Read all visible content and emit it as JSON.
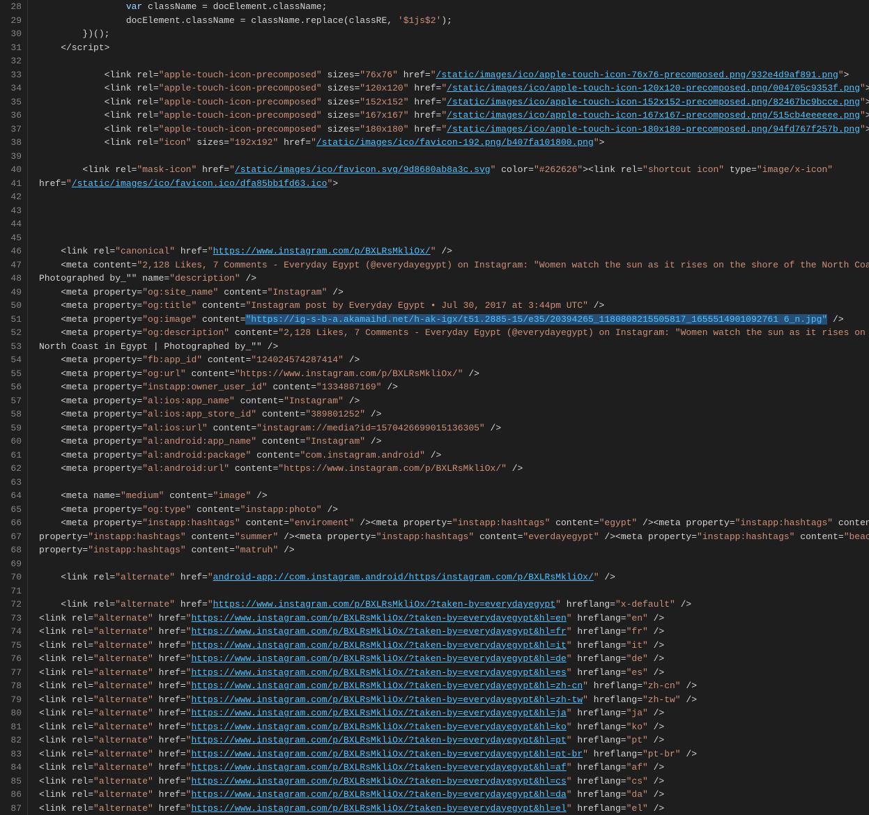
{
  "lines": [
    {
      "num": 28,
      "html": "<span class='plain'>                <span class='js-var'>var</span> className = docElement.className;</span>"
    },
    {
      "num": 29,
      "html": "<span class='plain'>                docElement.className = className.replace(classRE, <span class='js-string'>'$1js$2'</span>);</span>"
    },
    {
      "num": 30,
      "html": "<span class='plain'>        })();</span>"
    },
    {
      "num": 31,
      "html": "<span class='plain'>    &lt;/script&gt;</span>"
    },
    {
      "num": 32,
      "html": ""
    },
    {
      "num": 33,
      "html": "<span class='plain'>            &lt;link rel=<span class='attr-value'>\"apple-touch-icon-precomposed\"</span> sizes=<span class='attr-value'>\"76x76\"</span> href=<span class='attr-value'>\"<span class='link'>/static/images/ico/apple-touch-icon-76x76-precomposed.png/932e4d9af891.png</span>\"</span>&gt;</span>"
    },
    {
      "num": 34,
      "html": "<span class='plain'>            &lt;link rel=<span class='attr-value'>\"apple-touch-icon-precomposed\"</span> sizes=<span class='attr-value'>\"120x120\"</span> href=<span class='attr-value'>\"<span class='link'>/static/images/ico/apple-touch-icon-120x120-precomposed.png/004705c9353f.png</span>\"</span>&gt;</span>"
    },
    {
      "num": 35,
      "html": "<span class='plain'>            &lt;link rel=<span class='attr-value'>\"apple-touch-icon-precomposed\"</span> sizes=<span class='attr-value'>\"152x152\"</span> href=<span class='attr-value'>\"<span class='link'>/static/images/ico/apple-touch-icon-152x152-precomposed.png/82467bc9bcce.png</span>\"</span>&gt;</span>"
    },
    {
      "num": 36,
      "html": "<span class='plain'>            &lt;link rel=<span class='attr-value'>\"apple-touch-icon-precomposed\"</span> sizes=<span class='attr-value'>\"167x167\"</span> href=<span class='attr-value'>\"<span class='link'>/static/images/ico/apple-touch-icon-167x167-precomposed.png/515cb4eeeeee.png</span>\"</span>&gt;</span>"
    },
    {
      "num": 37,
      "html": "<span class='plain'>            &lt;link rel=<span class='attr-value'>\"apple-touch-icon-precomposed\"</span> sizes=<span class='attr-value'>\"180x180\"</span> href=<span class='attr-value'>\"<span class='link'>/static/images/ico/apple-touch-icon-180x180-precomposed.png/94fd767f257b.png</span>\"</span>&gt;</span>"
    },
    {
      "num": 38,
      "html": "<span class='plain'>            &lt;link rel=<span class='attr-value'>\"icon\"</span> sizes=<span class='attr-value'>\"192x192\"</span> href=<span class='attr-value'>\"<span class='link'>/static/images/ico/favicon-192.png/b407fa101800.png</span>\"</span>&gt;</span>"
    },
    {
      "num": 39,
      "html": ""
    },
    {
      "num": 40,
      "html": "<span class='plain'>        &lt;link rel=<span class='attr-value'>\"mask-icon\"</span> href=<span class='attr-value'>\"<span class='link'>/static/images/ico/favicon.svg/9d8680ab8a3c.svg</span>\"</span> color=<span class='attr-value'>\"#262626\"</span>&gt;&lt;link rel=<span class='attr-value'>\"shortcut icon\"</span> type=<span class='attr-value'>\"image/x-icon\"</span></span>"
    },
    {
      "num": 41,
      "html": "<span class='plain'>href=<span class='attr-value'>\"<span class='link'>/static/images/ico/favicon.ico/dfa85bb1fd63.ico</span>\"</span>&gt;</span>"
    },
    {
      "num": 42,
      "html": ""
    },
    {
      "num": 43,
      "html": ""
    },
    {
      "num": 44,
      "html": ""
    },
    {
      "num": 45,
      "html": ""
    },
    {
      "num": 46,
      "html": "<span class='plain'>    &lt;link rel=<span class='attr-value'>\"canonical\"</span> href=<span class='attr-value'>\"<span class='link'>https://www.instagram.com/p/BXLRsMkliOx/</span>\"</span> /&gt;</span>"
    },
    {
      "num": 47,
      "html": "<span class='plain'>    &lt;meta content=<span class='attr-value'>\"2,128 Likes, 7 Comments - Everyday Egypt (@everydayegypt) on Instagram: &quot;Women watch the sun as it rises on the shore of the North Coast in Egypt |</span></span>"
    },
    {
      "num": 48,
      "html": "<span class='plain'>Photographed by_&quot;&quot; name=<span class='attr-value'>\"description\"</span> /&gt;</span>"
    },
    {
      "num": 49,
      "html": "<span class='plain'>    &lt;meta property=<span class='attr-value'>\"og:site_name\"</span> content=<span class='attr-value'>\"Instagram\"</span> /&gt;</span>"
    },
    {
      "num": 50,
      "html": "<span class='plain'>    &lt;meta property=<span class='attr-value'>\"og:title\"</span> content=<span class='attr-value'>\"Instagram post by Everyday Egypt • Jul 30, 2017 at 3:44pm UTC\"</span> /&gt;</span>"
    },
    {
      "num": 51,
      "html": "<span class='plain'>    &lt;meta property=<span class='attr-value'>\"og:image\"</span> content=<span class='highlight-selection'>\"https://ig-s-b-a.akamaihd.net/h-ak-igx/t51.2885-15/e35/20394265_1180808215505817_1655514901092761 6_n.jpg\"</span> /&gt;</span>"
    },
    {
      "num": 52,
      "html": "<span class='plain'>    &lt;meta property=<span class='attr-value'>\"og:description\"</span> content=<span class='attr-value'>\"2,128 Likes, 7 Comments - Everyday Egypt (@everydayegypt) on Instagram: &quot;Women watch the sun as it rises on the shore of the</span></span>"
    },
    {
      "num": 53,
      "html": "<span class='plain'>North Coast in Egypt | Photographed by_&quot;&quot; /&gt;</span>"
    },
    {
      "num": 54,
      "html": "<span class='plain'>    &lt;meta property=<span class='attr-value'>\"fb:app_id\"</span> content=<span class='attr-value'>\"124024574287414\"</span> /&gt;</span>"
    },
    {
      "num": 55,
      "html": "<span class='plain'>    &lt;meta property=<span class='attr-value'>\"og:url\"</span> content=<span class='attr-value'>\"https://www.instagram.com/p/BXLRsMkliOx/\"</span> /&gt;</span>"
    },
    {
      "num": 56,
      "html": "<span class='plain'>    &lt;meta property=<span class='attr-value'>\"instapp:owner_user_id\"</span> content=<span class='attr-value'>\"1334887169\"</span> /&gt;</span>"
    },
    {
      "num": 57,
      "html": "<span class='plain'>    &lt;meta property=<span class='attr-value'>\"al:ios:app_name\"</span> content=<span class='attr-value'>\"Instagram\"</span> /&gt;</span>"
    },
    {
      "num": 58,
      "html": "<span class='plain'>    &lt;meta property=<span class='attr-value'>\"al:ios:app_store_id\"</span> content=<span class='attr-value'>\"389801252\"</span> /&gt;</span>"
    },
    {
      "num": 59,
      "html": "<span class='plain'>    &lt;meta property=<span class='attr-value'>\"al:ios:url\"</span> content=<span class='attr-value'>\"instagram://media?id=1570426699015136305\"</span> /&gt;</span>"
    },
    {
      "num": 60,
      "html": "<span class='plain'>    &lt;meta property=<span class='attr-value'>\"al:android:app_name\"</span> content=<span class='attr-value'>\"Instagram\"</span> /&gt;</span>"
    },
    {
      "num": 61,
      "html": "<span class='plain'>    &lt;meta property=<span class='attr-value'>\"al:android:package\"</span> content=<span class='attr-value'>\"com.instagram.android\"</span> /&gt;</span>"
    },
    {
      "num": 62,
      "html": "<span class='plain'>    &lt;meta property=<span class='attr-value'>\"al:android:url\"</span> content=<span class='attr-value'>\"https://www.instagram.com/p/BXLRsMkliOx/\"</span> /&gt;</span>"
    },
    {
      "num": 63,
      "html": ""
    },
    {
      "num": 64,
      "html": "<span class='plain'>    &lt;meta name=<span class='attr-value'>\"medium\"</span> content=<span class='attr-value'>\"image\"</span> /&gt;</span>"
    },
    {
      "num": 65,
      "html": "<span class='plain'>    &lt;meta property=<span class='attr-value'>\"og:type\"</span> content=<span class='attr-value'>\"instapp:photo\"</span> /&gt;</span>"
    },
    {
      "num": 66,
      "html": "<span class='plain'>    &lt;meta property=<span class='attr-value'>\"instapp:hashtags\"</span> content=<span class='attr-value'>\"enviroment\"</span> /&gt;&lt;meta property=<span class='attr-value'>\"instapp:hashtags\"</span> content=<span class='attr-value'>\"egypt\"</span> /&gt;&lt;meta property=<span class='attr-value'>\"instapp:hashtags\"</span> content=<span class='attr-value'>\"sunrise\"</span> /&gt;&lt;meta</span>"
    },
    {
      "num": 67,
      "html": "<span class='plain'>property=<span class='attr-value'>\"instapp:hashtags\"</span> content=<span class='attr-value'>\"summer\"</span> /&gt;&lt;meta property=<span class='attr-value'>\"instapp:hashtags\"</span> content=<span class='attr-value'>\"everdayegypt\"</span> /&gt;&lt;meta property=<span class='attr-value'>\"instapp:hashtags\"</span> content=<span class='attr-value'>\"beaches\"</span> /&gt;&lt;meta</span>"
    },
    {
      "num": 68,
      "html": "<span class='plain'>property=<span class='attr-value'>\"instapp:hashtags\"</span> content=<span class='attr-value'>\"matruh\"</span> /&gt;</span>"
    },
    {
      "num": 69,
      "html": ""
    },
    {
      "num": 70,
      "html": "<span class='plain'>    &lt;link rel=<span class='attr-value'>\"alternate\"</span> href=<span class='attr-value'>\"<span class='link'>android-app://com.instagram.android/https/instagram.com/p/BXLRsMkliOx/</span>\"</span> /&gt;</span>"
    },
    {
      "num": 71,
      "html": ""
    },
    {
      "num": 72,
      "html": "<span class='plain'>    &lt;link rel=<span class='attr-value'>\"alternate\"</span> href=<span class='attr-value'>\"<span class='link'>https://www.instagram.com/p/BXLRsMkliOx/?taken-by=everydayegypt</span>\"</span> hreflang=<span class='attr-value'>\"x-default\"</span> /&gt;</span>"
    },
    {
      "num": 73,
      "html": "<span class='plain'>&lt;link rel=<span class='attr-value'>\"alternate\"</span> href=<span class='attr-value'>\"<span class='link'>https://www.instagram.com/p/BXLRsMkliOx/?taken-by=everydayegypt&amp;hl=en</span>\"</span> hreflang=<span class='attr-value'>\"en\"</span> /&gt;</span>"
    },
    {
      "num": 74,
      "html": "<span class='plain'>&lt;link rel=<span class='attr-value'>\"alternate\"</span> href=<span class='attr-value'>\"<span class='link'>https://www.instagram.com/p/BXLRsMkliOx/?taken-by=everydayegypt&amp;hl=fr</span>\"</span> hreflang=<span class='attr-value'>\"fr\"</span> /&gt;</span>"
    },
    {
      "num": 75,
      "html": "<span class='plain'>&lt;link rel=<span class='attr-value'>\"alternate\"</span> href=<span class='attr-value'>\"<span class='link'>https://www.instagram.com/p/BXLRsMkliOx/?taken-by=everydayegypt&amp;hl=it</span>\"</span> hreflang=<span class='attr-value'>\"it\"</span> /&gt;</span>"
    },
    {
      "num": 76,
      "html": "<span class='plain'>&lt;link rel=<span class='attr-value'>\"alternate\"</span> href=<span class='attr-value'>\"<span class='link'>https://www.instagram.com/p/BXLRsMkliOx/?taken-by=everydayegypt&amp;hl=de</span>\"</span> hreflang=<span class='attr-value'>\"de\"</span> /&gt;</span>"
    },
    {
      "num": 77,
      "html": "<span class='plain'>&lt;link rel=<span class='attr-value'>\"alternate\"</span> href=<span class='attr-value'>\"<span class='link'>https://www.instagram.com/p/BXLRsMkliOx/?taken-by=everydayegypt&amp;hl=es</span>\"</span> hreflang=<span class='attr-value'>\"es\"</span> /&gt;</span>"
    },
    {
      "num": 78,
      "html": "<span class='plain'>&lt;link rel=<span class='attr-value'>\"alternate\"</span> href=<span class='attr-value'>\"<span class='link'>https://www.instagram.com/p/BXLRsMkliOx/?taken-by=everydayegypt&amp;hl=zh-cn</span>\"</span> hreflang=<span class='attr-value'>\"zh-cn\"</span> /&gt;</span>"
    },
    {
      "num": 79,
      "html": "<span class='plain'>&lt;link rel=<span class='attr-value'>\"alternate\"</span> href=<span class='attr-value'>\"<span class='link'>https://www.instagram.com/p/BXLRsMkliOx/?taken-by=everydayegypt&amp;hl=zh-tw</span>\"</span> hreflang=<span class='attr-value'>\"zh-tw\"</span> /&gt;</span>"
    },
    {
      "num": 80,
      "html": "<span class='plain'>&lt;link rel=<span class='attr-value'>\"alternate\"</span> href=<span class='attr-value'>\"<span class='link'>https://www.instagram.com/p/BXLRsMkliOx/?taken-by=everydayegypt&amp;hl=ja</span>\"</span> hreflang=<span class='attr-value'>\"ja\"</span> /&gt;</span>"
    },
    {
      "num": 81,
      "html": "<span class='plain'>&lt;link rel=<span class='attr-value'>\"alternate\"</span> href=<span class='attr-value'>\"<span class='link'>https://www.instagram.com/p/BXLRsMkliOx/?taken-by=everydayegypt&amp;hl=ko</span>\"</span> hreflang=<span class='attr-value'>\"ko\"</span> /&gt;</span>"
    },
    {
      "num": 82,
      "html": "<span class='plain'>&lt;link rel=<span class='attr-value'>\"alternate\"</span> href=<span class='attr-value'>\"<span class='link'>https://www.instagram.com/p/BXLRsMkliOx/?taken-by=everydayegypt&amp;hl=pt</span>\"</span> hreflang=<span class='attr-value'>\"pt\"</span> /&gt;</span>"
    },
    {
      "num": 83,
      "html": "<span class='plain'>&lt;link rel=<span class='attr-value'>\"alternate\"</span> href=<span class='attr-value'>\"<span class='link'>https://www.instagram.com/p/BXLRsMkliOx/?taken-by=everydayegypt&amp;hl=pt-br</span>\"</span> hreflang=<span class='attr-value'>\"pt-br\"</span> /&gt;</span>"
    },
    {
      "num": 84,
      "html": "<span class='plain'>&lt;link rel=<span class='attr-value'>\"alternate\"</span> href=<span class='attr-value'>\"<span class='link'>https://www.instagram.com/p/BXLRsMkliOx/?taken-by=everydayegypt&amp;hl=af</span>\"</span> hreflang=<span class='attr-value'>\"af\"</span> /&gt;</span>"
    },
    {
      "num": 85,
      "html": "<span class='plain'>&lt;link rel=<span class='attr-value'>\"alternate\"</span> href=<span class='attr-value'>\"<span class='link'>https://www.instagram.com/p/BXLRsMkliOx/?taken-by=everydayegypt&amp;hl=cs</span>\"</span> hreflang=<span class='attr-value'>\"cs\"</span> /&gt;</span>"
    },
    {
      "num": 86,
      "html": "<span class='plain'>&lt;link rel=<span class='attr-value'>\"alternate\"</span> href=<span class='attr-value'>\"<span class='link'>https://www.instagram.com/p/BXLRsMkliOx/?taken-by=everydayegypt&amp;hl=da</span>\"</span> hreflang=<span class='attr-value'>\"da\"</span> /&gt;</span>"
    },
    {
      "num": 87,
      "html": "<span class='plain'>&lt;link rel=<span class='attr-value'>\"alternate\"</span> href=<span class='attr-value'>\"<span class='link'>https://www.instagram.com/p/BXLRsMkliOx/?taken-by=everydayegypt&amp;hl=el</span>\"</span> hreflang=<span class='attr-value'>\"el\"</span> /&gt;</span>"
    }
  ]
}
